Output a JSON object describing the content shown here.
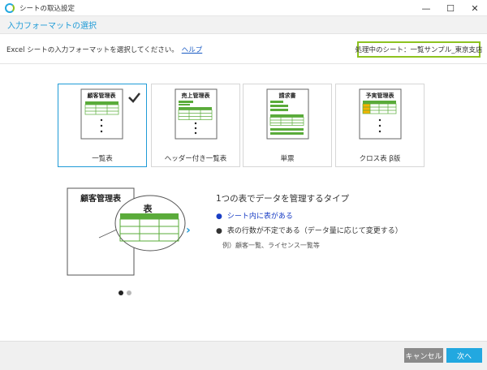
{
  "window": {
    "title": "シートの取込設定"
  },
  "header": {
    "title": "入力フォーマットの選択"
  },
  "instruction": {
    "text": "Excel シートの入力フォーマットを選択してください。",
    "help_link": "ヘルプ"
  },
  "current_sheet": {
    "label": "処理中のシート：一覧サンプル_東京支店"
  },
  "formats": [
    {
      "label": "一覧表",
      "thumb_title": "顧客管理表",
      "selected": true
    },
    {
      "label": "ヘッダー付き一覧表",
      "thumb_title": "売上管理表",
      "selected": false
    },
    {
      "label": "単票",
      "thumb_title": "請求書",
      "selected": false
    },
    {
      "label": "クロス表 β版",
      "thumb_title": "予実管理表",
      "selected": false
    }
  ],
  "preview": {
    "doc_title": "顧客管理表",
    "zoom_title": "表",
    "title": "1つの表でデータを管理するタイプ",
    "bullets": [
      "シート内に表がある",
      "表の行数が不定である（データ量に応じて変更する）"
    ],
    "example": "例）顧客一覧、ライセンス一覧等"
  },
  "pager": {
    "pages": 2,
    "current": 1
  },
  "buttons": {
    "cancel": "キャンセル",
    "next": "次へ"
  },
  "colors": {
    "accent": "#22a8e0",
    "green": "#5aab3a",
    "yellow": "#f5b400",
    "highlight_text": "#1a3ec4"
  }
}
